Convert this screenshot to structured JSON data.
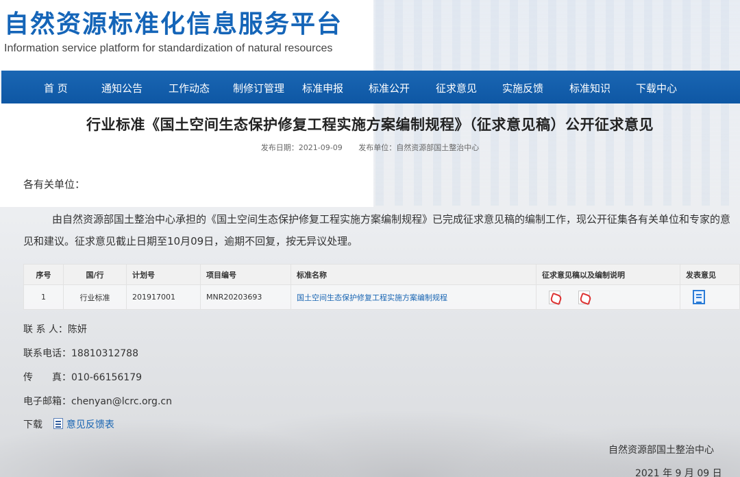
{
  "header": {
    "title_cn": "自然资源标准化信息服务平台",
    "title_en": "Information service platform for standardization of natural resources"
  },
  "nav": {
    "items": [
      {
        "label": "首 页"
      },
      {
        "label": "通知公告"
      },
      {
        "label": "工作动态"
      },
      {
        "label": "制修订管理"
      },
      {
        "label": "标准申报"
      },
      {
        "label": "标准公开"
      },
      {
        "label": "征求意见"
      },
      {
        "label": "实施反馈"
      },
      {
        "label": "标准知识"
      },
      {
        "label": "下载中心"
      }
    ]
  },
  "article": {
    "title": "行业标准《国土空间生态保护修复工程实施方案编制规程》（征求意见稿）公开征求意见",
    "publish_date": "发布日期：2021-09-09",
    "publisher": "发布单位：自然资源部国土整治中心",
    "salutation": "各有关单位：",
    "body": "由自然资源部国土整治中心承担的《国土空间生态保护修复工程实施方案编制规程》已完成征求意见稿的编制工作，现公开征集各有关单位和专家的意见和建议。征求意见截止日期至10月09日，逾期不回复，按无异议处理。"
  },
  "table": {
    "headers": [
      "序号",
      "国/行",
      "计划号",
      "项目编号",
      "标准名称",
      "征求意见稿以及编制说明",
      "发表意见"
    ],
    "rows": [
      {
        "index": "1",
        "type": "行业标准",
        "plan_no": "201917001",
        "project_no": "MNR20203693",
        "name": "国土空间生态保护修复工程实施方案编制规程"
      }
    ],
    "icons": {
      "draft": "pdf-icon",
      "comment": "document-list-icon"
    }
  },
  "contact": {
    "person": "联 系 人：陈妍",
    "phone": "联系电话：18810312788",
    "fax": "传　　真：010-66156179",
    "email": "电子邮箱：chenyan@lcrc.org.cn",
    "download_label": "下载",
    "download_link": "意见反馈表"
  },
  "signature": {
    "org": "自然资源部国土整治中心",
    "date": "2021 年 9 月 09 日"
  },
  "colors": {
    "brand": "#1565b8",
    "nav_bg": "#0e57a4",
    "link": "#1a66b3"
  }
}
